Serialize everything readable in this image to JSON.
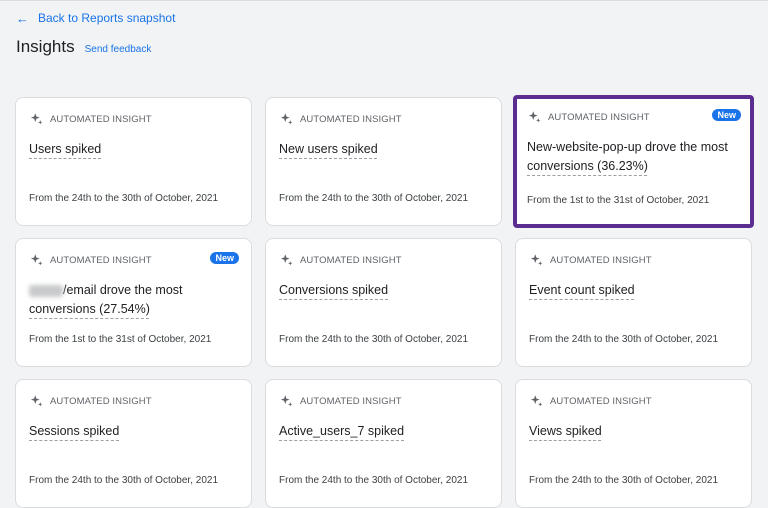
{
  "nav": {
    "back_label": "Back to Reports snapshot",
    "back_icon": "arrow-left-icon"
  },
  "header": {
    "title": "Insights",
    "feedback_label": "Send feedback"
  },
  "colors": {
    "accent": "#1a73e8",
    "highlight": "#5c2d91",
    "background": "#f1f3f4"
  },
  "cards": [
    {
      "type": "AUTOMATED INSIGHT",
      "badge": "",
      "title_a": "Users spiked",
      "title_b": "",
      "date": "From the 24th to the 30th of October, 2021"
    },
    {
      "type": "AUTOMATED INSIGHT",
      "badge": "",
      "title_a": "New users spiked",
      "title_b": "",
      "date": "From the 24th to the 30th of October, 2021"
    },
    {
      "type": "AUTOMATED INSIGHT",
      "badge": "New",
      "title_a": "New-website-pop-up drove the most",
      "title_b": "conversions (36.23%)",
      "date": "From the 1st to the 31st of October, 2021"
    },
    {
      "type": "AUTOMATED INSIGHT",
      "badge": "New",
      "title_a": "/email drove the most",
      "title_b": "conversions (27.54%)",
      "date": "From the 1st to the 31st of October, 2021"
    },
    {
      "type": "AUTOMATED INSIGHT",
      "badge": "",
      "title_a": "Conversions spiked",
      "title_b": "",
      "date": "From the 24th to the 30th of October, 2021"
    },
    {
      "type": "AUTOMATED INSIGHT",
      "badge": "",
      "title_a": "Event count spiked",
      "title_b": "",
      "date": "From the 24th to the 30th of October, 2021"
    },
    {
      "type": "AUTOMATED INSIGHT",
      "badge": "",
      "title_a": "Sessions spiked",
      "title_b": "",
      "date": "From the 24th to the 30th of October, 2021"
    },
    {
      "type": "AUTOMATED INSIGHT",
      "badge": "",
      "title_a": "Active_users_7 spiked",
      "title_b": "",
      "date": "From the 24th to the 30th of October, 2021"
    },
    {
      "type": "AUTOMATED INSIGHT",
      "badge": "",
      "title_a": "Views spiked",
      "title_b": "",
      "date": "From the 24th to the 30th of October, 2021"
    }
  ]
}
